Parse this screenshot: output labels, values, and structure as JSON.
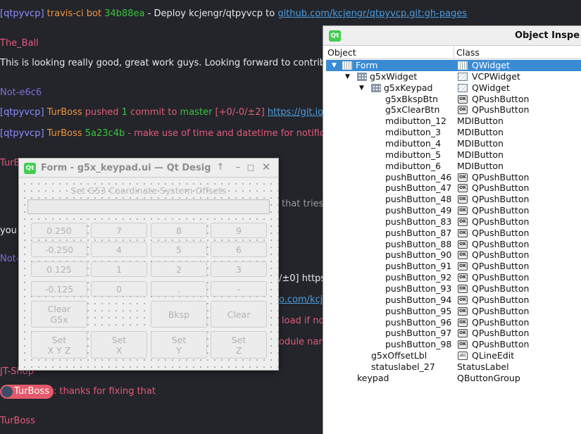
{
  "chat": {
    "line1": {
      "prefix": "[qtpyvcp]",
      "bot": "travis-ci bot",
      "hash": "34b88ea",
      "text": " - Deploy kcjengr/qtpyvcp to ",
      "link": "github.com/kcjengr/qtpyvcp.git:gh-pages"
    },
    "user1": "The_Ball",
    "msg1": "This is looking really good, great work guys. Looking forward to contribut",
    "user2": "Not-e6c6",
    "line2": {
      "prefix": "[qtpyvcp]",
      "who": "TurBoss",
      "pushed": " pushed ",
      "count": "1",
      "commit": " commit to ",
      "branch": "master",
      "diff": " [+0/-0/±2] ",
      "link": "https://git.io/fjsy"
    },
    "line3": {
      "prefix": "[qtpyvcp]",
      "who": "TurBoss",
      "hash": "5a23c4b",
      "text": " - make use of time and datetime for notificatio"
    },
    "user3": "TurB",
    "frag1": "that tries",
    "frag2": "you",
    "user4": "Not-",
    "frag3": "/±0] https:",
    "frag4": "o.com/kcje",
    "frag5": "load if no",
    "frag6": "odule nam",
    "user5": "JT-Shop",
    "pill": "TurBoss",
    "msg2": ": thanks for fixing that",
    "user6": "TurBoss"
  },
  "inspector": {
    "title": "Object Inspe",
    "col_object": "Object",
    "col_class": "Class",
    "rows": [
      {
        "name": "Form",
        "cls": "QWidget"
      },
      {
        "name": "g5xWidget",
        "cls": "VCPWidget"
      },
      {
        "name": "g5xKeypad",
        "cls": "QWidget"
      },
      {
        "name": "g5xBkspBtn",
        "cls": "QPushButton"
      },
      {
        "name": "g5xClearBtn",
        "cls": "QPushButton"
      },
      {
        "name": "mdibutton_12",
        "cls": "MDIButton"
      },
      {
        "name": "mdibutton_3",
        "cls": "MDIButton"
      },
      {
        "name": "mdibutton_4",
        "cls": "MDIButton"
      },
      {
        "name": "mdibutton_5",
        "cls": "MDIButton"
      },
      {
        "name": "mdibutton_6",
        "cls": "MDIButton"
      },
      {
        "name": "pushButton_46",
        "cls": "QPushButton"
      },
      {
        "name": "pushButton_47",
        "cls": "QPushButton"
      },
      {
        "name": "pushButton_48",
        "cls": "QPushButton"
      },
      {
        "name": "pushButton_49",
        "cls": "QPushButton"
      },
      {
        "name": "pushButton_83",
        "cls": "QPushButton"
      },
      {
        "name": "pushButton_87",
        "cls": "QPushButton"
      },
      {
        "name": "pushButton_88",
        "cls": "QPushButton"
      },
      {
        "name": "pushButton_90",
        "cls": "QPushButton"
      },
      {
        "name": "pushButton_91",
        "cls": "QPushButton"
      },
      {
        "name": "pushButton_92",
        "cls": "QPushButton"
      },
      {
        "name": "pushButton_93",
        "cls": "QPushButton"
      },
      {
        "name": "pushButton_94",
        "cls": "QPushButton"
      },
      {
        "name": "pushButton_95",
        "cls": "QPushButton"
      },
      {
        "name": "pushButton_96",
        "cls": "QPushButton"
      },
      {
        "name": "pushButton_97",
        "cls": "QPushButton"
      },
      {
        "name": "pushButton_98",
        "cls": "QPushButton"
      },
      {
        "name": "g5xOffsetLbl",
        "cls": "QLineEdit"
      },
      {
        "name": "statuslabel_27",
        "cls": "StatusLabel"
      },
      {
        "name": "keypad",
        "cls": "QButtonGroup"
      }
    ]
  },
  "form": {
    "title": "Form - g5x_keypad.ui — Qt Desig",
    "offset_label": "Set G53 Coordinate System Offsets",
    "keys": {
      "k0250": "0.250",
      "k7": "7",
      "k8": "8",
      "k9": "9",
      "km0250": "-0.250",
      "k4": "4",
      "k5": "5",
      "k6": "6",
      "k0125": "0.125",
      "k1": "1",
      "k2": "2",
      "k3": "3",
      "km0125": "-0.125",
      "k0": "0",
      "kdot": ".",
      "kminus": "-",
      "clear_g5x": "Clear\nG5x",
      "bksp": "Bksp",
      "clear": "Clear",
      "set_xyz": "Set\nX Y Z",
      "set_x": "Set\nX",
      "set_y": "Set\nY",
      "set_z": "Set\nZ"
    }
  }
}
